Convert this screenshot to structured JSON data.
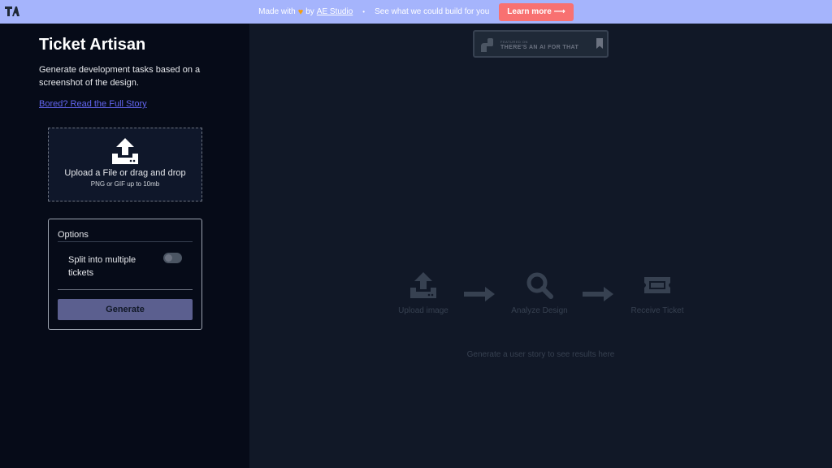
{
  "banner": {
    "made_with": "Made with",
    "by": "by",
    "studio": "AE Studio",
    "dot": "•",
    "tagline": "See what we could build for you",
    "learn_more": "Learn more ⟶",
    "logo_icon": "ta-logo-icon",
    "heart_icon": "heart-icon"
  },
  "sidebar": {
    "title": "Ticket Artisan",
    "description": "Generate development tasks based on a screenshot of the design.",
    "story_link": "Bored? Read the Full Story",
    "upload": {
      "icon": "upload-tray-icon",
      "title": "Upload a File or drag and drop",
      "subtitle": "PNG or GIF up to 10mb"
    },
    "options": {
      "title": "Options",
      "split_label": "Split into multiple tickets",
      "split_enabled": false,
      "generate_label": "Generate"
    }
  },
  "main": {
    "featured": {
      "small": "FEATURED ON",
      "big": "THERE'S AN AI FOR THAT"
    },
    "steps": [
      {
        "label": "Upload image",
        "icon": "upload-tray-icon"
      },
      {
        "label": "Analyze Design",
        "icon": "magnifier-icon"
      },
      {
        "label": "Receive Ticket",
        "icon": "ticket-icon"
      }
    ],
    "hint": "Generate a user story to see results here"
  },
  "colors": {
    "banner_bg": "#a5b4fc",
    "learn_btn": "#f87171",
    "sidebar_bg": "#060b18",
    "main_bg": "#111827",
    "link": "#6366f1",
    "generate_btn": "#5b5f8f"
  }
}
